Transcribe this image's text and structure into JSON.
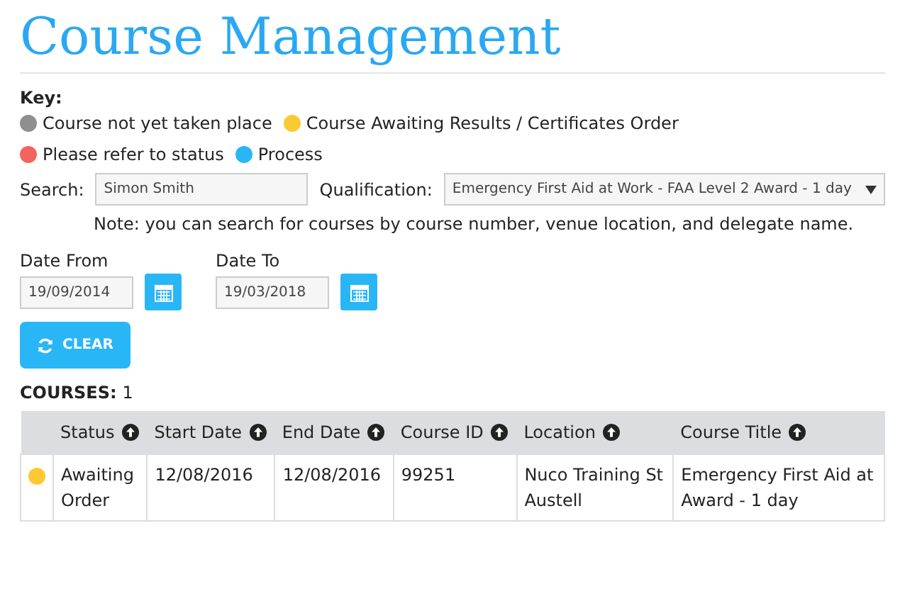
{
  "title": "Course Management",
  "key": {
    "label": "Key:",
    "items": [
      {
        "label": "Course not yet taken place",
        "color": "#8f8f8f"
      },
      {
        "label": "Course Awaiting Results / Certificates Order",
        "color": "#fbc932"
      },
      {
        "label": "Please refer to status",
        "color": "#f4645f"
      },
      {
        "label": "Process",
        "color": "#29b6f6"
      }
    ]
  },
  "search": {
    "label": "Search:",
    "value": "Simon Smith"
  },
  "qualification": {
    "label": "Qualification:",
    "value": "Emergency First Aid at Work - FAA Level 2 Award - 1 day"
  },
  "note": "Note: you can search for courses by course number, venue location, and delegate name.",
  "date_from": {
    "label": "Date From",
    "value": "19/09/2014"
  },
  "date_to": {
    "label": "Date To",
    "value": "19/03/2018"
  },
  "clear_button": "CLEAR",
  "courses": {
    "label": "COURSES:",
    "count": "1"
  },
  "table": {
    "columns": [
      "Status",
      "Start Date",
      "End Date",
      "Course ID",
      "Location",
      "Course Title"
    ],
    "rows": [
      {
        "color": "#fbc932",
        "cells": [
          [
            "Awaiting",
            "Order"
          ],
          [
            "12/08/2016"
          ],
          [
            "12/08/2016"
          ],
          [
            "99251"
          ],
          [
            "Nuco Training St",
            "Austell"
          ],
          [
            "Emergency First Aid at",
            "Award - 1 day"
          ]
        ]
      }
    ]
  }
}
